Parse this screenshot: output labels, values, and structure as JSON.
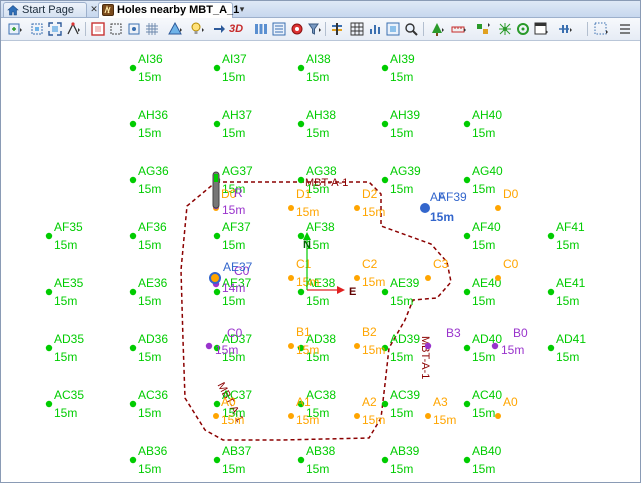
{
  "tabs": [
    {
      "label": "Start Page",
      "icon": "home-icon",
      "active": false
    },
    {
      "label": "Holes nearby MBT_A_1",
      "icon": "holes-map-icon",
      "active": true
    }
  ],
  "toolbar": {
    "icons": [
      "new-hole-icon",
      "select-area-icon",
      "zoom-extents-icon",
      "pan-icon",
      "frame-icon",
      "select-icon",
      "grid-snap-icon",
      "triangle-icon",
      "bulb-icon",
      "light-icon",
      "view-3d-icon",
      "columns-icon",
      "layers-icon",
      "settings-icon",
      "filter-icon",
      "bars-icon",
      "table-icon",
      "chart-icon",
      "plan-icon",
      "zoom-icon",
      "tree-icon",
      "ruler-icon",
      "link-icon",
      "network-icon",
      "ring-icon",
      "window-icon",
      "flow-icon",
      "dotted-icon",
      "options-icon"
    ],
    "label_3d": "3D"
  },
  "colors": {
    "green": "#00cc00",
    "orange": "#ffa500",
    "purple": "#9933cc",
    "blue": "#3366cc",
    "boundary": "#8b0000",
    "red": "#e02020"
  },
  "holes": [
    {
      "name": "AI36",
      "depth": "15m"
    },
    {
      "name": "AI37",
      "depth": "15m"
    },
    {
      "name": "AI38",
      "depth": "15m"
    },
    {
      "name": "AI39",
      "depth": "15m"
    },
    {
      "name": "AH36",
      "depth": "15m"
    },
    {
      "name": "AH37",
      "depth": "15m"
    },
    {
      "name": "AH38",
      "depth": "15m"
    },
    {
      "name": "AH39",
      "depth": "15m"
    },
    {
      "name": "AH40",
      "depth": "15m"
    },
    {
      "name": "AG36",
      "depth": "15m"
    },
    {
      "name": "AG37",
      "depth": "15m"
    },
    {
      "name": "AG38",
      "depth": "15m"
    },
    {
      "name": "AG39",
      "depth": "15m"
    },
    {
      "name": "AG40",
      "depth": "15m"
    },
    {
      "name": "AF35",
      "depth": "15m"
    },
    {
      "name": "AF36",
      "depth": "15m"
    },
    {
      "name": "AF37",
      "depth": "15m"
    },
    {
      "name": "AF38",
      "depth": "15m"
    },
    {
      "name": "AF40",
      "depth": "15m"
    },
    {
      "name": "AF41",
      "depth": "15m"
    },
    {
      "name": "AE35",
      "depth": "15m"
    },
    {
      "name": "AE36",
      "depth": "15m"
    },
    {
      "name": "AE37",
      "depth": "15m"
    },
    {
      "name": "AE38",
      "depth": "15m"
    },
    {
      "name": "AE39",
      "depth": "15m"
    },
    {
      "name": "AE40",
      "depth": "15m"
    },
    {
      "name": "AE41",
      "depth": "15m"
    },
    {
      "name": "AD35",
      "depth": "15m"
    },
    {
      "name": "AD36",
      "depth": "15m"
    },
    {
      "name": "AD37",
      "depth": "15m"
    },
    {
      "name": "AD38",
      "depth": "15m"
    },
    {
      "name": "AD39",
      "depth": "15m"
    },
    {
      "name": "AD40",
      "depth": "15m"
    },
    {
      "name": "AD41",
      "depth": "15m"
    },
    {
      "name": "AC35",
      "depth": "15m"
    },
    {
      "name": "AC36",
      "depth": "15m"
    },
    {
      "name": "AC37",
      "depth": "15m"
    },
    {
      "name": "AC38",
      "depth": "15m"
    },
    {
      "name": "AC39",
      "depth": "15m"
    },
    {
      "name": "AC40",
      "depth": "15m"
    },
    {
      "name": "AB36",
      "depth": "15m"
    },
    {
      "name": "AB37",
      "depth": "15m"
    },
    {
      "name": "AB38",
      "depth": "15m"
    },
    {
      "name": "AB39",
      "depth": "15m"
    },
    {
      "name": "AB40",
      "depth": "15m"
    }
  ],
  "orange_holes": [
    {
      "name": "D0",
      "depth": ""
    },
    {
      "name": "D1",
      "depth": "15m"
    },
    {
      "name": "D2",
      "depth": "15m"
    },
    {
      "name": "D0",
      "depth": ""
    },
    {
      "name": "C1",
      "depth": "15m"
    },
    {
      "name": "C2",
      "depth": "15m"
    },
    {
      "name": "C3",
      "depth": ""
    },
    {
      "name": "C0",
      "depth": ""
    },
    {
      "name": "B1",
      "depth": "15m"
    },
    {
      "name": "B2",
      "depth": "15m"
    },
    {
      "name": "A0",
      "depth": "15m"
    },
    {
      "name": "A1",
      "depth": "15m"
    },
    {
      "name": "A2",
      "depth": "15m"
    },
    {
      "name": "A3",
      "depth": "15m"
    },
    {
      "name": "A0",
      "depth": ""
    }
  ],
  "purple_holes": [
    {
      "name": "R",
      "depth": "15m"
    },
    {
      "name": "C0",
      "depth": "14m"
    },
    {
      "name": "C0",
      "depth": "15m"
    },
    {
      "name": "B3",
      "depth": ""
    },
    {
      "name": "B0",
      "depth": "15m"
    }
  ],
  "blue_holes": [
    {
      "name": "AE37",
      "depth": ""
    },
    {
      "name": "AF39",
      "depth": "15m"
    },
    {
      "name": "AF",
      "depth": ""
    }
  ],
  "boundary_labels": [
    "MBT-A-1",
    "MBT-A-1",
    "MBT-A-1"
  ],
  "axis_labels": {
    "north": "N",
    "east": "E"
  }
}
